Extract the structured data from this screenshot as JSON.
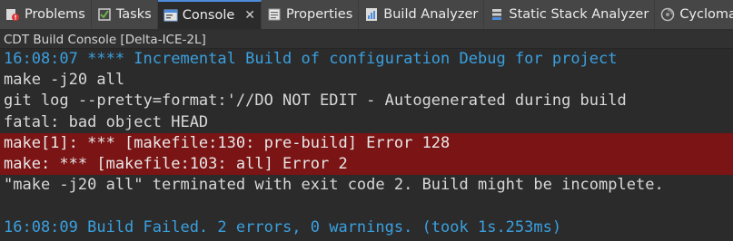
{
  "tabs": [
    {
      "label": "Problems",
      "icon": "problems-icon",
      "active": false
    },
    {
      "label": "Tasks",
      "icon": "tasks-icon",
      "active": false
    },
    {
      "label": "Console",
      "icon": "console-icon",
      "active": true,
      "close": "✕"
    },
    {
      "label": "Properties",
      "icon": "properties-icon",
      "active": false
    },
    {
      "label": "Build Analyzer",
      "icon": "build-analyzer-icon",
      "active": false
    },
    {
      "label": "Static Stack Analyzer",
      "icon": "static-stack-analyzer-icon",
      "active": false
    },
    {
      "label": "Cyclomatic Complexity",
      "icon": "cyclomatic-complexity-icon",
      "active": false
    }
  ],
  "console_title": "CDT Build Console [Delta-ICE-2L]",
  "colors": {
    "info_text": "#3aa0e0",
    "error_background": "#7b1414",
    "active_tab_accent": "#4c8cdb"
  },
  "lines": [
    {
      "type": "info",
      "text": "16:08:07 **** Incremental Build of configuration Debug for project"
    },
    {
      "type": "plain",
      "text": "make -j20 all"
    },
    {
      "type": "plain",
      "text": "git log --pretty=format:'//DO NOT EDIT - Autogenerated during build"
    },
    {
      "type": "plain",
      "text": "fatal: bad object HEAD"
    },
    {
      "type": "err",
      "text": "make[1]: *** [makefile:130: pre-build] Error 128"
    },
    {
      "type": "err",
      "text": "make: *** [makefile:103: all] Error 2"
    },
    {
      "type": "plain",
      "text": "\"make -j20 all\" terminated with exit code 2. Build might be incomplete."
    },
    {
      "type": "blank",
      "text": ""
    },
    {
      "type": "info",
      "text": "16:08:09 Build Failed. 2 errors, 0 warnings. (took 1s.253ms)"
    }
  ]
}
